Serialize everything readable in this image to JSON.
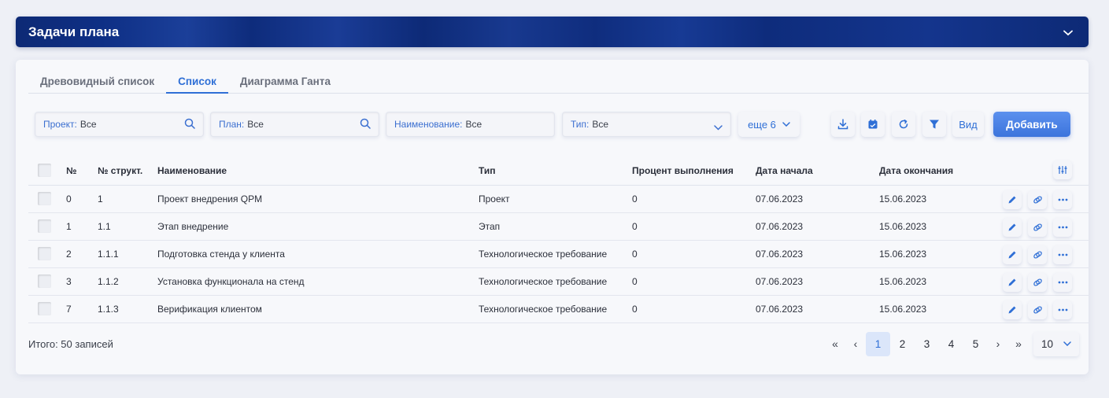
{
  "header": {
    "title": "Задачи плана",
    "collapse_icon": "chevron-down-icon"
  },
  "tabs": [
    {
      "label": "Древовидный список",
      "active": false
    },
    {
      "label": "Список",
      "active": true
    },
    {
      "label": "Диаграмма Ганта",
      "active": false
    }
  ],
  "filters": {
    "project": {
      "label": "Проект:",
      "value": "Все"
    },
    "plan": {
      "label": "План:",
      "value": "Все"
    },
    "name": {
      "label": "Наименование:",
      "value": "Все"
    },
    "type": {
      "label": "Тип:",
      "value": "Все"
    },
    "more_label": "еще 6"
  },
  "toolbar": {
    "icons": [
      "download-icon",
      "calendar-icon",
      "refresh-icon",
      "filter-icon"
    ],
    "view_label": "Вид",
    "add_label": "Добавить"
  },
  "table": {
    "columns": [
      "№",
      "№ структ.",
      "Наименование",
      "Тип",
      "Процент выполнения",
      "Дата начала",
      "Дата окончания"
    ],
    "rows": [
      {
        "num": "0",
        "struct": "1",
        "name": "Проект внедрения QPM",
        "type": "Проект",
        "percent": "0",
        "start": "07.06.2023",
        "end": "15.06.2023"
      },
      {
        "num": "1",
        "struct": "1.1",
        "name": "Этап внедрение",
        "type": "Этап",
        "percent": "0",
        "start": "07.06.2023",
        "end": "15.06.2023"
      },
      {
        "num": "2",
        "struct": "1.1.1",
        "name": "Подготовка стенда у клиента",
        "type": "Технологическое требование",
        "percent": "0",
        "start": "07.06.2023",
        "end": "15.06.2023"
      },
      {
        "num": "3",
        "struct": "1.1.2",
        "name": "Установка функционала на стенд",
        "type": "Технологическое требование",
        "percent": "0",
        "start": "07.06.2023",
        "end": "15.06.2023"
      },
      {
        "num": "7",
        "struct": "1.1.3",
        "name": "Верификация клиентом",
        "type": "Технологическое требование",
        "percent": "0",
        "start": "07.06.2023",
        "end": "15.06.2023"
      }
    ]
  },
  "footer": {
    "total": "Итого: 50 записей",
    "pages": [
      "1",
      "2",
      "3",
      "4",
      "5"
    ],
    "current_page": "1",
    "nav": {
      "first": "«",
      "prev": "‹",
      "next": "›",
      "last": "»"
    },
    "page_size": "10"
  },
  "colors": {
    "accent": "#2f6fd6",
    "header_bg": "#0e2c7c"
  }
}
